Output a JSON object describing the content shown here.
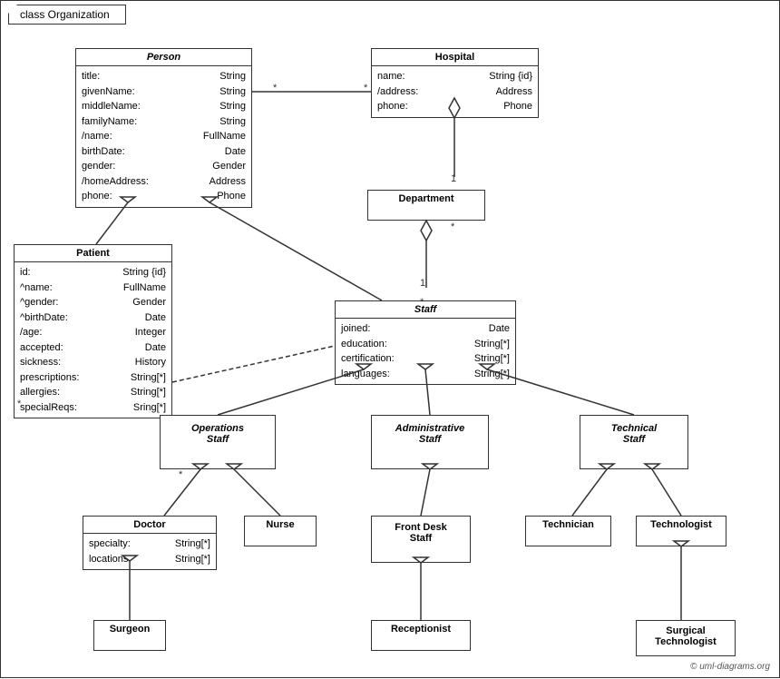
{
  "diagram": {
    "title": "class Organization",
    "copyright": "© uml-diagrams.org",
    "classes": {
      "person": {
        "name": "Person",
        "italic": true,
        "attrs": [
          [
            "title:",
            "String"
          ],
          [
            "givenName:",
            "String"
          ],
          [
            "middleName:",
            "String"
          ],
          [
            "familyName:",
            "String"
          ],
          [
            "/name:",
            "FullName"
          ],
          [
            "birthDate:",
            "Date"
          ],
          [
            "gender:",
            "Gender"
          ],
          [
            "/homeAddress:",
            "Address"
          ],
          [
            "phone:",
            "Phone"
          ]
        ]
      },
      "hospital": {
        "name": "Hospital",
        "italic": false,
        "attrs": [
          [
            "name:",
            "String {id}"
          ],
          [
            "/address:",
            "Address"
          ],
          [
            "phone:",
            "Phone"
          ]
        ]
      },
      "patient": {
        "name": "Patient",
        "italic": false,
        "attrs": [
          [
            "id:",
            "String {id}"
          ],
          [
            "^name:",
            "FullName"
          ],
          [
            "^gender:",
            "Gender"
          ],
          [
            "^birthDate:",
            "Date"
          ],
          [
            "/age:",
            "Integer"
          ],
          [
            "accepted:",
            "Date"
          ],
          [
            "sickness:",
            "History"
          ],
          [
            "prescriptions:",
            "String[*]"
          ],
          [
            "allergies:",
            "String[*]"
          ],
          [
            "specialReqs:",
            "Sring[*]"
          ]
        ]
      },
      "department": {
        "name": "Department",
        "italic": false,
        "attrs": []
      },
      "staff": {
        "name": "Staff",
        "italic": true,
        "attrs": [
          [
            "joined:",
            "Date"
          ],
          [
            "education:",
            "String[*]"
          ],
          [
            "certification:",
            "String[*]"
          ],
          [
            "languages:",
            "String[*]"
          ]
        ]
      },
      "operations_staff": {
        "name": "Operations Staff",
        "italic": true,
        "attrs": []
      },
      "administrative_staff": {
        "name": "Administrative Staff",
        "italic": true,
        "attrs": []
      },
      "technical_staff": {
        "name": "Technical Staff",
        "italic": true,
        "attrs": []
      },
      "doctor": {
        "name": "Doctor",
        "italic": false,
        "attrs": [
          [
            "specialty:",
            "String[*]"
          ],
          [
            "locations:",
            "String[*]"
          ]
        ]
      },
      "nurse": {
        "name": "Nurse",
        "italic": false,
        "attrs": []
      },
      "front_desk_staff": {
        "name": "Front Desk Staff",
        "italic": false,
        "attrs": []
      },
      "technician": {
        "name": "Technician",
        "italic": false,
        "attrs": []
      },
      "technologist": {
        "name": "Technologist",
        "italic": false,
        "attrs": []
      },
      "surgeon": {
        "name": "Surgeon",
        "italic": false,
        "attrs": []
      },
      "receptionist": {
        "name": "Receptionist",
        "italic": false,
        "attrs": []
      },
      "surgical_technologist": {
        "name": "Surgical Technologist",
        "italic": false,
        "attrs": []
      }
    }
  }
}
